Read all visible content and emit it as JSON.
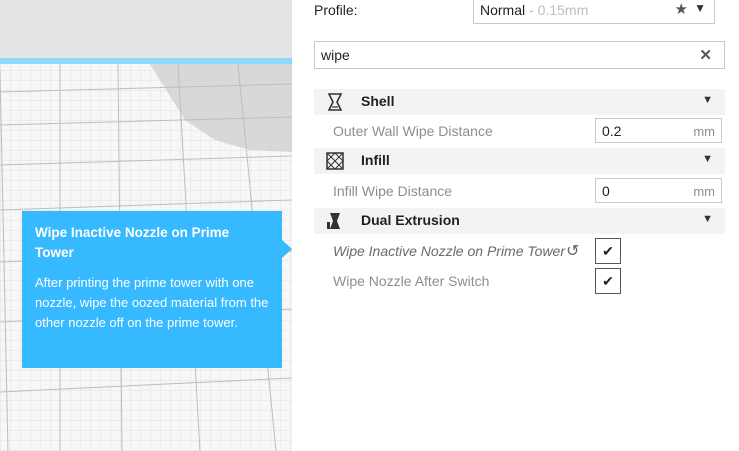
{
  "profile": {
    "label": "Profile:",
    "value": "Normal",
    "sub": "- 0.15mm",
    "star_icon": "star-icon",
    "chevron_icon": "chevron-down-icon"
  },
  "search": {
    "value": "wipe",
    "clear_icon": "close-icon"
  },
  "categories": [
    {
      "label": "Shell",
      "icon": "shell-icon"
    },
    {
      "label": "Infill",
      "icon": "infill-icon"
    },
    {
      "label": "Dual Extrusion",
      "icon": "dual-extrusion-icon"
    }
  ],
  "settings": {
    "outer_wall_wipe": {
      "label": "Outer Wall Wipe Distance",
      "value": "0.2",
      "unit": "mm"
    },
    "infill_wipe": {
      "label": "Infill Wipe Distance",
      "value": "0",
      "unit": "mm"
    },
    "wipe_inactive": {
      "label": "Wipe Inactive Nozzle on Prime Tower",
      "checked": true,
      "reset_icon": "reset-icon"
    },
    "wipe_after_switch": {
      "label": "Wipe Nozzle After Switch",
      "checked": true
    }
  },
  "tooltip": {
    "title": "Wipe Inactive Nozzle on Prime Tower",
    "body": "After printing the prime tower with one nozzle, wipe the oozed material from the other nozzle off on the prime tower."
  },
  "colors": {
    "accent": "#36b9ff",
    "category_bg": "#f3f3f3"
  }
}
